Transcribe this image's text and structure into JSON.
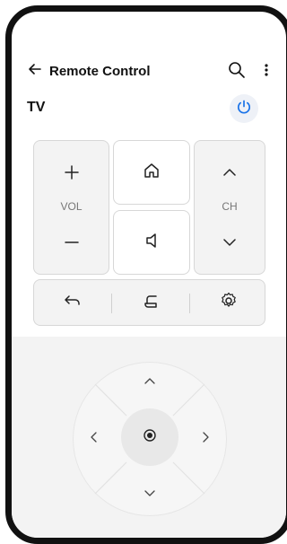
{
  "app_bar": {
    "back_icon": "arrow-left-icon",
    "title": "Remote Control",
    "search_icon": "search-icon",
    "more_icon": "more-vertical-icon"
  },
  "device": {
    "name": "TV",
    "power_icon": "power-icon",
    "power_accent": "#1a73e8"
  },
  "controls": {
    "vol_label": "VOL",
    "ch_label": "CH",
    "home_icon": "home-icon",
    "mute_icon": "speaker-icon",
    "back_icon": "return-arrow-icon",
    "input_icon": "input-source-icon",
    "settings_icon": "settings-icon",
    "vol_up_icon": "plus-icon",
    "vol_down_icon": "minus-icon",
    "ch_up_icon": "chevron-up-icon",
    "ch_down_icon": "chevron-down-icon"
  },
  "dpad": {
    "up_icon": "chevron-up-icon",
    "down_icon": "chevron-down-icon",
    "left_icon": "chevron-left-icon",
    "right_icon": "chevron-right-icon",
    "ok_icon": "ok-dot-icon"
  }
}
